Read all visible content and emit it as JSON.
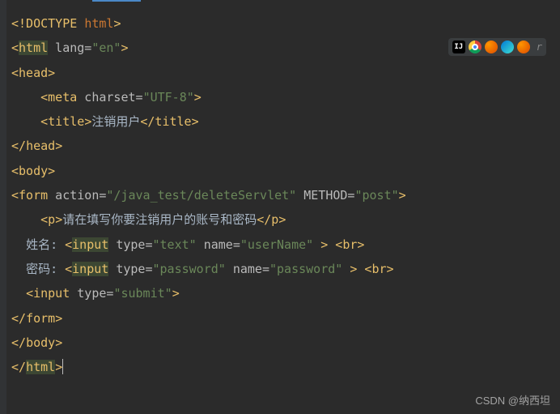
{
  "code": {
    "l1": {
      "open": "<!DOCTYPE ",
      "kw": "html",
      "close": ">"
    },
    "l2": {
      "open": "<",
      "tag": "html",
      "attrs": " lang=",
      "val": "\"en\"",
      "close": ">"
    },
    "l3": {
      "open": "<",
      "tag": "head",
      "close": ">"
    },
    "l4": {
      "indent": "    ",
      "open": "<",
      "tag": "meta",
      "attrs": " charset=",
      "val": "\"UTF-8\"",
      "close": ">"
    },
    "l5": {
      "indent": "    ",
      "open": "<",
      "tag": "title",
      "close1": ">",
      "text": "注销用户",
      "open2": "</",
      "tag2": "title",
      "close2": ">"
    },
    "l6": {
      "open": "</",
      "tag": "head",
      "close": ">"
    },
    "l7": {
      "open": "<",
      "tag": "body",
      "close": ">"
    },
    "l8": {
      "open": "<",
      "tag": "form",
      "a1": " action=",
      "v1": "\"/java_test/deleteServlet\"",
      "a2": " METHOD=",
      "v2": "\"post\"",
      "close": ">"
    },
    "l9": {
      "indent": "    ",
      "open": "<",
      "tag": "p",
      "close1": ">",
      "text": "请在填写你要注销用户的账号和密码",
      "open2": "</",
      "tag2": "p",
      "close2": ">"
    },
    "l10": {
      "indent": "  ",
      "label": "姓名: ",
      "open": "<",
      "tag": "input",
      "a1": " type=",
      "v1": "\"text\"",
      "a2": " name=",
      "v2": "\"userName\"",
      "close": " > ",
      "bopen": "<",
      "btag": "br",
      "bclose": ">"
    },
    "l11": {
      "indent": "  ",
      "label": "密码: ",
      "open": "<",
      "tag": "input",
      "a1": " type=",
      "v1": "\"password\"",
      "a2": " name=",
      "v2": "\"password\"",
      "close": " > ",
      "bopen": "<",
      "btag": "br",
      "bclose": ">"
    },
    "l12": {
      "indent": "  ",
      "open": "<",
      "tag": "input",
      "a1": " type=",
      "v1": "\"submit\"",
      "close": ">"
    },
    "l13": {
      "open": "</",
      "tag": "form",
      "close": ">"
    },
    "l14": {
      "open": "</",
      "tag": "body",
      "close": ">"
    },
    "l15": {
      "open": "</",
      "tag": "html",
      "close": ">"
    }
  },
  "toolbar": {
    "ide": "IJ",
    "run": "r"
  },
  "watermark": "CSDN @纳西坦"
}
